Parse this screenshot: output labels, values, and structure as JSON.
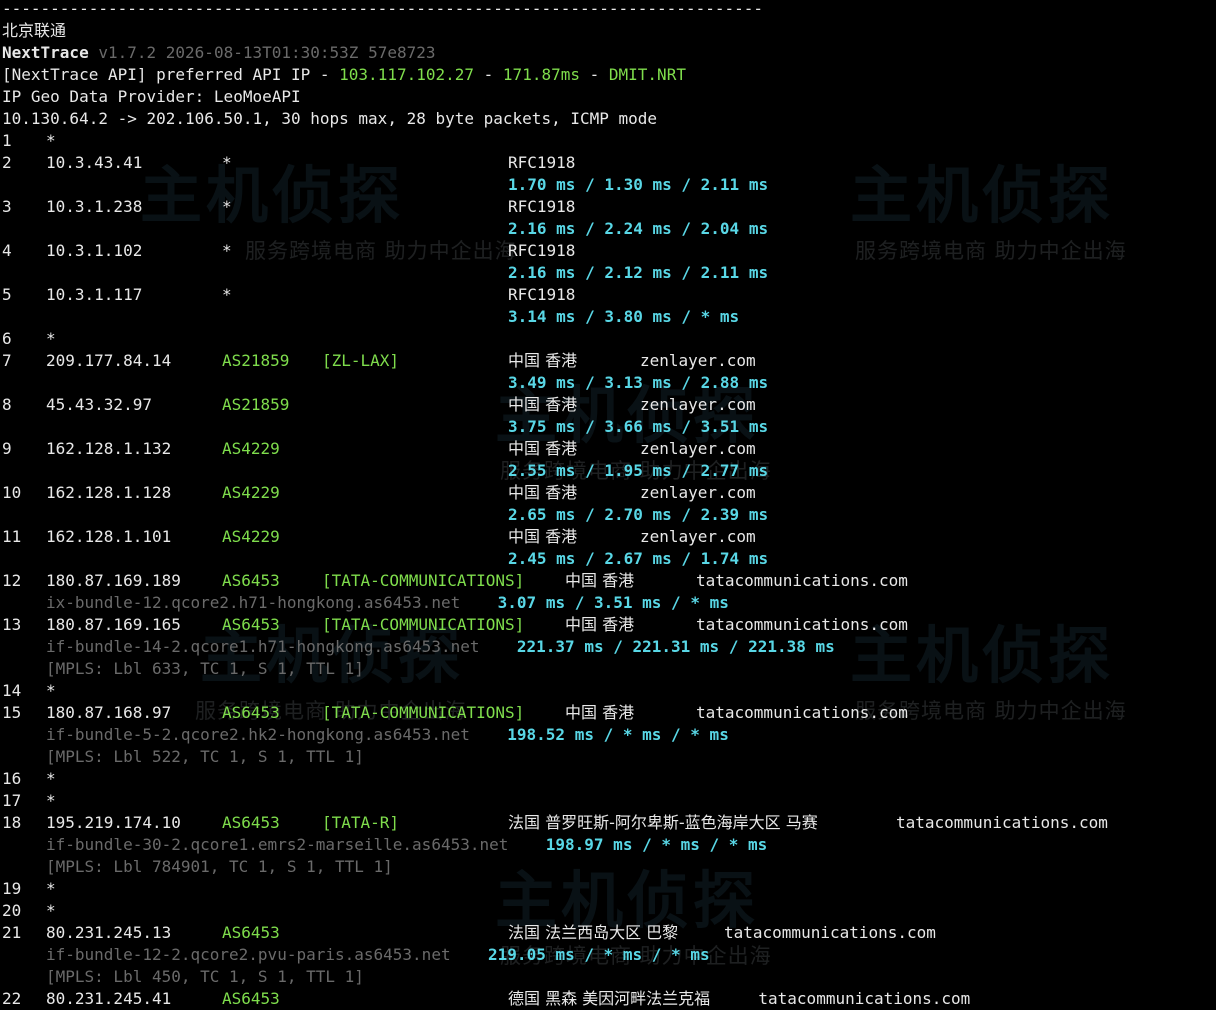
{
  "separator": "-------------------------------------------------------------------------------",
  "location_title": "北京联通",
  "app": {
    "name": "NextTrace",
    "version": "v1.7.2 2026-08-13T01:30:53Z 57e8723"
  },
  "api": {
    "prefix": "[NextTrace API] preferred API IP - ",
    "ip": "103.117.102.27",
    "sep1": " - ",
    "latency": "171.87ms",
    "sep2": " - ",
    "node": "DMIT.NRT"
  },
  "provider_line": "IP Geo Data Provider: LeoMoeAPI",
  "route_line": "10.130.64.2 -> 202.106.50.1, 30 hops max, 28 byte packets, ICMP mode",
  "watermark": {
    "title": "主机侦探",
    "subtitle": "服务跨境电商 助力中企出海"
  },
  "hops": [
    {
      "n": "1",
      "star": "*"
    },
    {
      "n": "2",
      "ip": "10.3.43.41",
      "asn": "*",
      "geo": "RFC1918",
      "rtt": "1.70 ms / 1.30 ms / 2.11 ms"
    },
    {
      "n": "3",
      "ip": "10.3.1.238",
      "asn": "*",
      "geo": "RFC1918",
      "rtt": "2.16 ms / 2.24 ms / 2.04 ms"
    },
    {
      "n": "4",
      "ip": "10.3.1.102",
      "asn": "*",
      "geo": "RFC1918",
      "rtt": "2.16 ms / 2.12 ms / 2.11 ms"
    },
    {
      "n": "5",
      "ip": "10.3.1.117",
      "asn": "*",
      "geo": "RFC1918",
      "rtt": "3.14 ms / 3.80 ms / * ms"
    },
    {
      "n": "6",
      "star": "*"
    },
    {
      "n": "7",
      "ip": "209.177.84.14",
      "asn": "AS21859",
      "tag": "[ZL-LAX]",
      "geo": "中国 香港",
      "domain": "zenlayer.com",
      "rtt": "3.49 ms / 3.13 ms / 2.88 ms"
    },
    {
      "n": "8",
      "ip": "45.43.32.97",
      "asn": "AS21859",
      "geo": "中国 香港",
      "domain": "zenlayer.com",
      "rtt": "3.75 ms / 3.66 ms / 3.51 ms"
    },
    {
      "n": "9",
      "ip": "162.128.1.132",
      "asn": "AS4229",
      "geo": "中国 香港",
      "domain": "zenlayer.com",
      "rtt": "2.55 ms / 1.95 ms / 2.77 ms"
    },
    {
      "n": "10",
      "ip": "162.128.1.128",
      "asn": "AS4229",
      "geo": "中国 香港",
      "domain": "zenlayer.com",
      "rtt": "2.65 ms / 2.70 ms / 2.39 ms"
    },
    {
      "n": "11",
      "ip": "162.128.1.101",
      "asn": "AS4229",
      "geo": "中国 香港",
      "domain": "zenlayer.com",
      "rtt": "2.45 ms / 2.67 ms / 1.74 ms"
    },
    {
      "n": "12",
      "ip": "180.87.169.189",
      "asn": "AS6453",
      "tag": "[TATA-COMMUNICATIONS]",
      "geo": "中国 香港",
      "domain": "tatacommunications.com",
      "host": "ix-bundle-12.qcore2.h71-hongkong.as6453.net",
      "rtt": "3.07 ms / 3.51 ms / * ms"
    },
    {
      "n": "13",
      "ip": "180.87.169.165",
      "asn": "AS6453",
      "tag": "[TATA-COMMUNICATIONS]",
      "geo": "中国 香港",
      "domain": "tatacommunications.com",
      "host": "if-bundle-14-2.qcore1.h71-hongkong.as6453.net",
      "rtt": "221.37 ms / 221.31 ms / 221.38 ms",
      "mpls": "[MPLS: Lbl 633, TC 1, S 1, TTL 1]"
    },
    {
      "n": "14",
      "star": "*"
    },
    {
      "n": "15",
      "ip": "180.87.168.97",
      "asn": "AS6453",
      "tag": "[TATA-COMMUNICATIONS]",
      "geo": "中国 香港",
      "domain": "tatacommunications.com",
      "host": "if-bundle-5-2.qcore2.hk2-hongkong.as6453.net",
      "rtt": "198.52 ms / * ms / * ms",
      "mpls": "[MPLS: Lbl 522, TC 1, S 1, TTL 1]"
    },
    {
      "n": "16",
      "star": "*"
    },
    {
      "n": "17",
      "star": "*"
    },
    {
      "n": "18",
      "ip": "195.219.174.10",
      "asn": "AS6453",
      "tag": "[TATA-R]",
      "geo": "法国 普罗旺斯-阿尔卑斯-蓝色海岸大区 马赛",
      "domain": "tatacommunications.com",
      "host": "if-bundle-30-2.qcore1.emrs2-marseille.as6453.net",
      "rtt": "198.97 ms / * ms / * ms",
      "mpls": "[MPLS: Lbl 784901, TC 1, S 1, TTL 1]"
    },
    {
      "n": "19",
      "star": "*"
    },
    {
      "n": "20",
      "star": "*"
    },
    {
      "n": "21",
      "ip": "80.231.245.13",
      "asn": "AS6453",
      "geo": "法国 法兰西岛大区 巴黎",
      "domain": "tatacommunications.com",
      "host": "if-bundle-12-2.qcore2.pvu-paris.as6453.net",
      "rtt": "219.05 ms / * ms / * ms",
      "mpls": "[MPLS: Lbl 450, TC 1, S 1, TTL 1]"
    },
    {
      "n": "22",
      "ip": "80.231.245.41",
      "asn": "AS6453",
      "geo": "德国 黑森 美因河畔法兰克福",
      "domain": "tatacommunications.com"
    }
  ]
}
